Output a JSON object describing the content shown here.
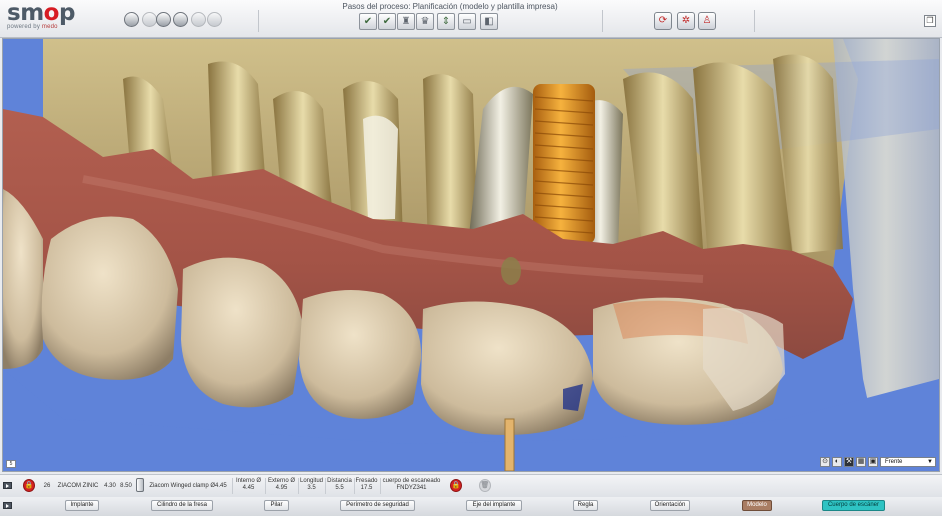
{
  "brand": {
    "wordmark_start": "sm",
    "wordmark_o": "o",
    "wordmark_end": "p",
    "powered_by": "powered by",
    "vendor": "medo"
  },
  "colors": {
    "brand_red": "#d71c23",
    "viewport_bg": "#5f83d9",
    "gingiva": "#a35a4c",
    "tooth": "#d8c7ab",
    "bone": "#c4ae6c",
    "implant": "#e0941f",
    "modelo_button": "#a97d63",
    "cuerpo_button": "#2ec3c3"
  },
  "toolbar_left_icons": [
    "monitor-icon",
    "info-icon",
    "binoculars-icon",
    "camera-icon",
    "undo-icon",
    "redo-icon"
  ],
  "process": {
    "title": "Pasos del proceso: Planificación (modelo y plantilla impresa)",
    "step_icons": [
      "model-check-icon",
      "scan-check-icon",
      "tooth-icon",
      "crown-icon",
      "implant-icon",
      "guide-icon",
      "sleeve-icon"
    ]
  },
  "view_toolbar_icons": [
    "rotate-view-icon",
    "target-icon",
    "person-view-icon"
  ],
  "viewport": {
    "orientation_select": "Frente",
    "corner_marker": "5"
  },
  "implant_info": {
    "position": "26",
    "brand": "ZIACOM ZINIC",
    "diameter": "4.30",
    "length": "8.50",
    "scan_body": "Ziacom Winged clamp Ø4.45",
    "internal_label": "Interno Ø",
    "internal_value": "4.45",
    "external_label": "Externo Ø",
    "external_value": "4.95",
    "longitud_label": "Longitud",
    "longitud_value": "3.5",
    "distancia_label": "Distancia",
    "distancia_value": "5.5",
    "fresado_label": "Fresado",
    "fresado_value": "17.5",
    "scanbody_label": "cuerpo de escaneado",
    "scanbody_value": "FNDYZ341"
  },
  "bottom_buttons": {
    "implante": "Implante",
    "cilindro": "Cilindro de la fresa",
    "pilar": "Pilar",
    "perimetro": "Perímetro de seguridad",
    "eje": "Eje del implante",
    "regla": "Regla",
    "orientacion": "Orientación",
    "modelo": "Modelo",
    "cuerpo": "Cuerpo de escáner"
  }
}
